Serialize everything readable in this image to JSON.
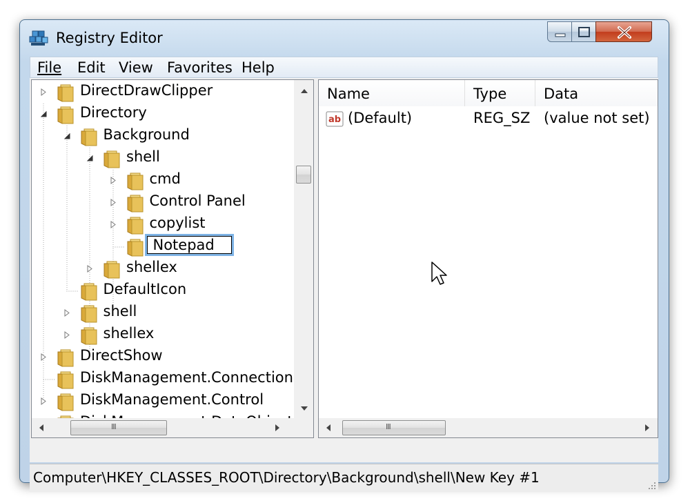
{
  "window": {
    "title": "Registry Editor"
  },
  "menu": [
    "File",
    "Edit",
    "View",
    "Favorites",
    "Help"
  ],
  "tree": {
    "nodes": [
      {
        "label": "DirectDrawClipper",
        "toggle": "collapsed"
      },
      {
        "label": "Directory",
        "toggle": "expanded"
      },
      {
        "label": "Background",
        "toggle": "expanded"
      },
      {
        "label": "shell",
        "toggle": "expanded"
      },
      {
        "label": "cmd",
        "toggle": "collapsed"
      },
      {
        "label": "Control Panel",
        "toggle": "collapsed"
      },
      {
        "label": "copylist",
        "toggle": "collapsed"
      },
      {
        "label": "Notepad",
        "toggle": "none",
        "editing": true
      },
      {
        "label": "shellex",
        "toggle": "collapsed"
      },
      {
        "label": "DefaultIcon",
        "toggle": "none"
      },
      {
        "label": "shell",
        "toggle": "collapsed"
      },
      {
        "label": "shellex",
        "toggle": "collapsed"
      },
      {
        "label": "DirectShow",
        "toggle": "collapsed"
      },
      {
        "label": "DiskManagement.Connection",
        "toggle": "none"
      },
      {
        "label": "DiskManagement.Control",
        "toggle": "collapsed"
      },
      {
        "label": "DiskManagement.DataObject",
        "toggle": "collapsed"
      }
    ]
  },
  "list": {
    "columns": [
      "Name",
      "Type",
      "Data"
    ],
    "rows": [
      {
        "icon": "string-value-icon",
        "icon_text": "ab",
        "name": "(Default)",
        "type": "REG_SZ",
        "data": "(value not set)"
      }
    ]
  },
  "status": {
    "path": "Computer\\HKEY_CLASSES_ROOT\\Directory\\Background\\shell\\New Key #1"
  },
  "colors": {
    "folder": "#e8c25a",
    "selection_border": "#7fb4e6",
    "titlebar": "#c3d8ec"
  }
}
